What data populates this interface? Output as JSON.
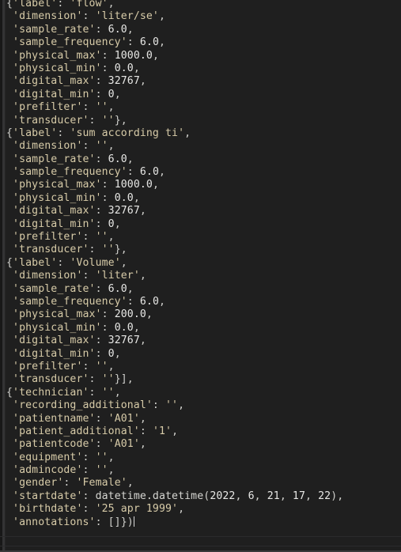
{
  "editor": {
    "theme": "dark",
    "background_color": "#1f1f1f",
    "string_color": "#d7cba8",
    "number_color": "#e8e8e6",
    "punctuation_color": "#d0d0cc",
    "caret_color": "#d8d8d8",
    "language": "python",
    "content_kind": "python-dict-repr"
  },
  "code": {
    "lines": [
      "{'label': 'flow',",
      " 'dimension': 'liter/se',",
      " 'sample_rate': 6.0,",
      " 'sample_frequency': 6.0,",
      " 'physical_max': 1000.0,",
      " 'physical_min': 0.0,",
      " 'digital_max': 32767,",
      " 'digital_min': 0,",
      " 'prefilter': '',",
      " 'transducer': ''},",
      "{'label': 'sum according ti',",
      " 'dimension': '',",
      " 'sample_rate': 6.0,",
      " 'sample_frequency': 6.0,",
      " 'physical_max': 1000.0,",
      " 'physical_min': 0.0,",
      " 'digital_max': 32767,",
      " 'digital_min': 0,",
      " 'prefilter': '',",
      " 'transducer': ''},",
      "{'label': 'Volume',",
      " 'dimension': 'liter',",
      " 'sample_rate': 6.0,",
      " 'sample_frequency': 6.0,",
      " 'physical_max': 200.0,",
      " 'physical_min': 0.0,",
      " 'digital_max': 32767,",
      " 'digital_min': 0,",
      " 'prefilter': '',",
      " 'transducer': ''}],",
      "{'technician': '',",
      " 'recording_additional': '',",
      " 'patientname': 'A01',",
      " 'patient_additional': '1',",
      " 'patientcode': 'A01',",
      " 'equipment': '',",
      " 'admincode': '',",
      " 'gender': 'Female',",
      " 'startdate': datetime.datetime(2022, 6, 21, 17, 22),",
      " 'birthdate': '25 apr 1999',",
      " 'annotations': []})"
    ],
    "caret_on_last_line": true
  },
  "signals": [
    {
      "label": "flow",
      "dimension": "liter/se",
      "sample_rate": "6.0",
      "sample_frequency": "6.0",
      "physical_max": "1000.0",
      "physical_min": "0.0",
      "digital_max": "32767",
      "digital_min": "0",
      "prefilter": "",
      "transducer": ""
    },
    {
      "label": "sum according ti",
      "dimension": "",
      "sample_rate": "6.0",
      "sample_frequency": "6.0",
      "physical_max": "1000.0",
      "physical_min": "0.0",
      "digital_max": "32767",
      "digital_min": "0",
      "prefilter": "",
      "transducer": ""
    },
    {
      "label": "Volume",
      "dimension": "liter",
      "sample_rate": "6.0",
      "sample_frequency": "6.0",
      "physical_max": "200.0",
      "physical_min": "0.0",
      "digital_max": "32767",
      "digital_min": "0",
      "prefilter": "",
      "transducer": ""
    }
  ],
  "header": {
    "technician": "",
    "recording_additional": "",
    "patientname": "A01",
    "patient_additional": "1",
    "patientcode": "A01",
    "equipment": "",
    "admincode": "",
    "gender": "Female",
    "startdate": "datetime.datetime(2022, 6, 21, 17, 22)",
    "birthdate": "25 apr 1999",
    "annotations": "[]"
  }
}
